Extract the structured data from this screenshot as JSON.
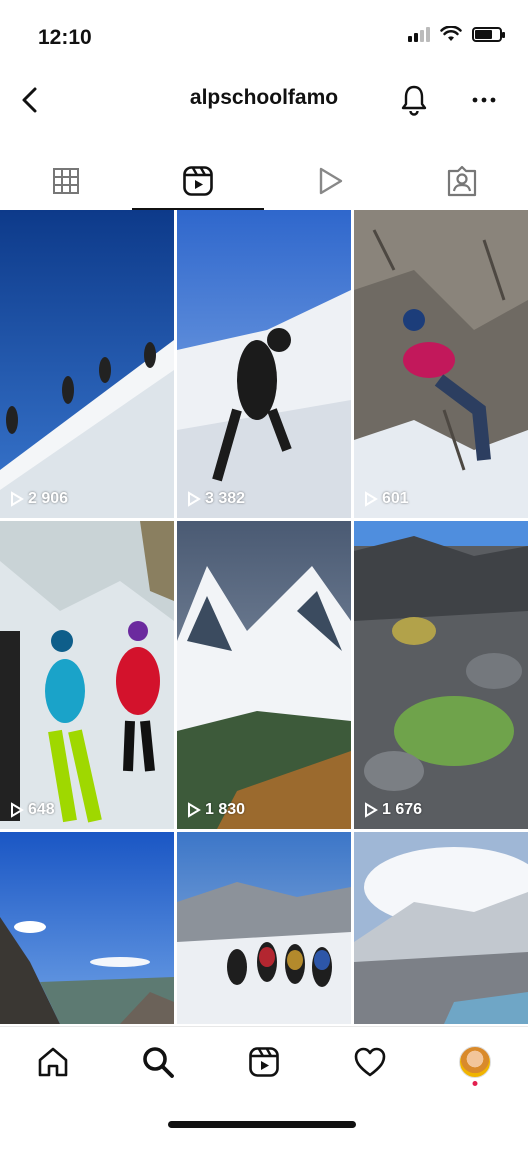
{
  "status_bar": {
    "time": "12:10"
  },
  "header": {
    "username": "alpschoolfamo"
  },
  "tabs": [
    {
      "name": "tab-posts-grid",
      "icon": "grid-icon",
      "active": false
    },
    {
      "name": "tab-reels",
      "icon": "reels-icon",
      "active": true
    },
    {
      "name": "tab-videos",
      "icon": "play-icon",
      "active": false
    },
    {
      "name": "tab-tagged",
      "icon": "tagged-icon",
      "active": false
    }
  ],
  "reels": [
    {
      "views": "2 906",
      "scene": "climbers on snowy ridge"
    },
    {
      "views": "3 382",
      "scene": "climber with ice axe on snow slope"
    },
    {
      "views": "601",
      "scene": "climber rappelling on rock face"
    },
    {
      "views": "648",
      "scene": "climbers in ice cave"
    },
    {
      "views": "1 830",
      "scene": "snowy mountain peaks"
    },
    {
      "views": "1 676",
      "scene": "rocks with moss"
    },
    {
      "views": "",
      "scene": "lake and mountain ridge"
    },
    {
      "views": "",
      "scene": "hikers on snowy trail"
    },
    {
      "views": "",
      "scene": "clouded mountain"
    }
  ],
  "bottom_nav": [
    "home-icon",
    "search-icon",
    "reels-icon",
    "heart-icon",
    "profile-avatar"
  ],
  "colors": {
    "accent_dot": "#e3204f",
    "text": "#111111"
  }
}
